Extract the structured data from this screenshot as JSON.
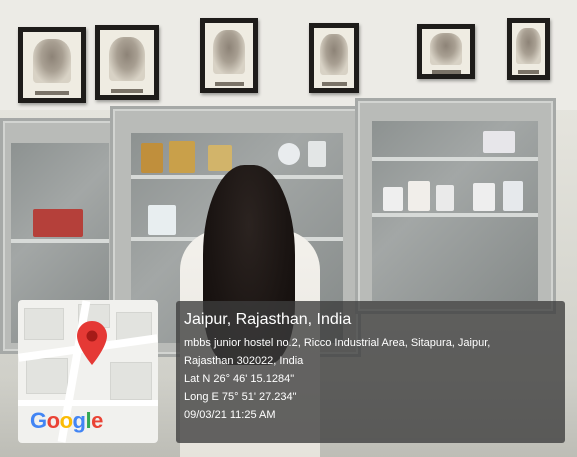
{
  "overlay": {
    "title": "Jaipur, Rajasthan, India",
    "address_line1": "mbbs junior hostel no.2, Ricco Industrial Area, Sitapura, Jaipur,",
    "address_line2": "Rajasthan 302022, India",
    "latitude": "Lat N 26° 46' 15.1284\"",
    "longitude": "Long E 75° 51' 27.234\"",
    "timestamp": "09/03/21 11:25 AM"
  },
  "map": {
    "icon": "map-pin-icon",
    "pin_color": "#e53935",
    "logo_letters": [
      "G",
      "o",
      "o",
      "g",
      "l",
      "e"
    ]
  },
  "colors": {
    "overlay_bg": "#3c3c3c",
    "google_blue": "#4285f4",
    "google_red": "#ea4335",
    "google_yellow": "#fbbc05",
    "google_green": "#34a853"
  }
}
